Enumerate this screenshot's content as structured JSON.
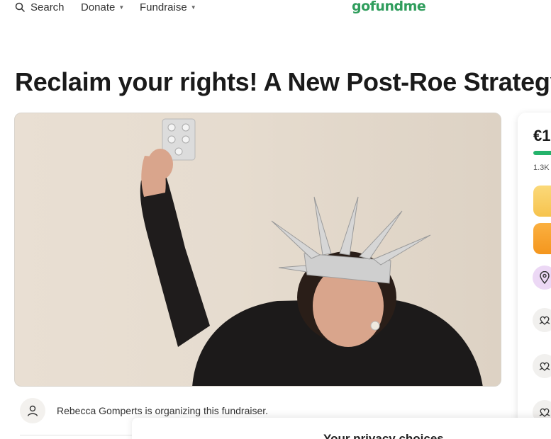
{
  "nav": {
    "search_label": "Search",
    "donate_label": "Donate",
    "fundraise_label": "Fundraise"
  },
  "brand": {
    "logo_text": "gofundme",
    "color": "#2f9d5c"
  },
  "page": {
    "title": "Reclaim your rights! A New Post-Roe Strategy"
  },
  "hero": {
    "image": "woman-holding-pill-blister-crown-photo"
  },
  "organizer": {
    "text": "Rebecca Gomperts is organizing this fundraiser."
  },
  "sidebar": {
    "amount_partial": "€1",
    "donations_partial": "1.3K",
    "progress_fraction": 0.9,
    "icons": [
      "map-pin-icon",
      "donor-heart-icon",
      "donor-heart-icon",
      "donor-heart-icon"
    ],
    "colors": {
      "progress": "#24b36b",
      "share": "#f6c34d",
      "donate": "#f4961e"
    }
  },
  "privacy": {
    "title_partial": "Your privacy choices"
  }
}
